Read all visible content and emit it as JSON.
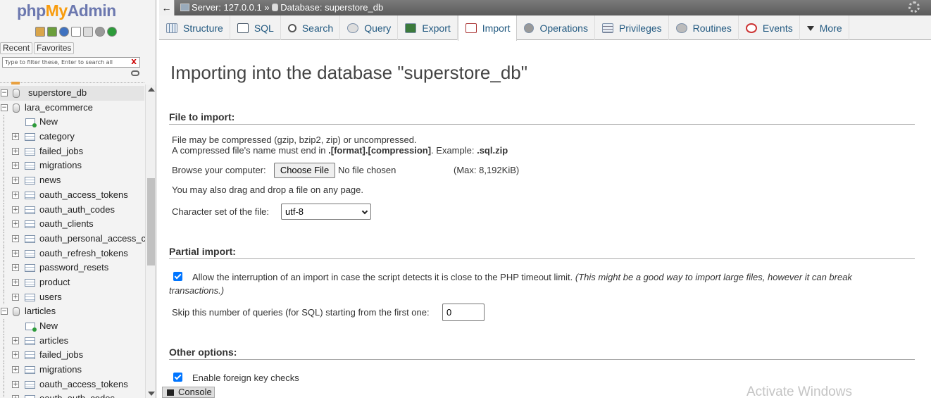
{
  "sidebar": {
    "logo_php": "php",
    "logo_my": "My",
    "logo_admin": "Admin",
    "tab_recent": "Recent",
    "tab_favorites": "Favorites",
    "filter_placeholder": "Type to filter these, Enter to search all",
    "filter_clear": "X",
    "tree": [
      {
        "label": "superstore_db",
        "type": "db",
        "level": 0,
        "expander": "−",
        "selected": true
      },
      {
        "label": "lara_ecommerce",
        "type": "db",
        "level": 0,
        "expander": "−"
      },
      {
        "label": "New",
        "type": "new",
        "level": 1
      },
      {
        "label": "category",
        "type": "table",
        "level": 1,
        "expander": "+"
      },
      {
        "label": "failed_jobs",
        "type": "table",
        "level": 1,
        "expander": "+"
      },
      {
        "label": "migrations",
        "type": "table",
        "level": 1,
        "expander": "+"
      },
      {
        "label": "news",
        "type": "table",
        "level": 1,
        "expander": "+"
      },
      {
        "label": "oauth_access_tokens",
        "type": "table",
        "level": 1,
        "expander": "+"
      },
      {
        "label": "oauth_auth_codes",
        "type": "table",
        "level": 1,
        "expander": "+"
      },
      {
        "label": "oauth_clients",
        "type": "table",
        "level": 1,
        "expander": "+"
      },
      {
        "label": "oauth_personal_access_c",
        "type": "table",
        "level": 1,
        "expander": "+"
      },
      {
        "label": "oauth_refresh_tokens",
        "type": "table",
        "level": 1,
        "expander": "+"
      },
      {
        "label": "password_resets",
        "type": "table",
        "level": 1,
        "expander": "+"
      },
      {
        "label": "product",
        "type": "table",
        "level": 1,
        "expander": "+"
      },
      {
        "label": "users",
        "type": "table",
        "level": 1,
        "expander": "+"
      },
      {
        "label": "larticles",
        "type": "db",
        "level": 0,
        "expander": "−"
      },
      {
        "label": "New",
        "type": "new",
        "level": 1
      },
      {
        "label": "articles",
        "type": "table",
        "level": 1,
        "expander": "+"
      },
      {
        "label": "failed_jobs",
        "type": "table",
        "level": 1,
        "expander": "+"
      },
      {
        "label": "migrations",
        "type": "table",
        "level": 1,
        "expander": "+"
      },
      {
        "label": "oauth_access_tokens",
        "type": "table",
        "level": 1,
        "expander": "+"
      },
      {
        "label": "oauth_auth_codes",
        "type": "table",
        "level": 1,
        "expander": "+"
      }
    ]
  },
  "topbar": {
    "back_icon": "←",
    "server_label": "Server: 127.0.0.1",
    "separator": "»",
    "database_label": "Database: superstore_db"
  },
  "menu": {
    "tabs": [
      {
        "label": "Structure",
        "icon": "structure"
      },
      {
        "label": "SQL",
        "icon": "sql"
      },
      {
        "label": "Search",
        "icon": "search"
      },
      {
        "label": "Query",
        "icon": "query"
      },
      {
        "label": "Export",
        "icon": "export"
      },
      {
        "label": "Import",
        "icon": "import",
        "active": true
      },
      {
        "label": "Operations",
        "icon": "operations"
      },
      {
        "label": "Privileges",
        "icon": "privileges"
      },
      {
        "label": "Routines",
        "icon": "routines"
      },
      {
        "label": "Events",
        "icon": "events"
      },
      {
        "label": "More",
        "icon": "more"
      }
    ]
  },
  "main": {
    "title": "Importing into the database \"superstore_db\"",
    "file_section": {
      "heading": "File to import:",
      "line1": "File may be compressed (gzip, bzip2, zip) or uncompressed.",
      "line2_prefix": "A compressed file's name must end in ",
      "line2_format": ".[format].[compression]",
      "line2_mid": ". Example: ",
      "line2_example": ".sql.zip",
      "browse_label": "Browse your computer:",
      "choose_button": "Choose File",
      "no_file": "No file chosen",
      "max_size": "(Max: 8,192KiB)",
      "drag_note": "You may also drag and drop a file on any page.",
      "charset_label": "Character set of the file:",
      "charset_value": "utf-8"
    },
    "partial_section": {
      "heading": "Partial import:",
      "allow_interrupt_checked": true,
      "allow_interrupt_label": "Allow the interruption of an import in case the script detects it is close to the PHP timeout limit.",
      "allow_interrupt_note_1": "(This might be a good way to import large files, however it can break",
      "allow_interrupt_note_2": "transactions.)",
      "skip_label": "Skip this number of queries (for SQL) starting from the first one:",
      "skip_value": "0"
    },
    "other_section": {
      "heading": "Other options:",
      "foreign_key_checked": true,
      "foreign_key_label": "Enable foreign key checks"
    }
  },
  "console": {
    "label": "Console"
  },
  "watermark": "Activate Windows"
}
